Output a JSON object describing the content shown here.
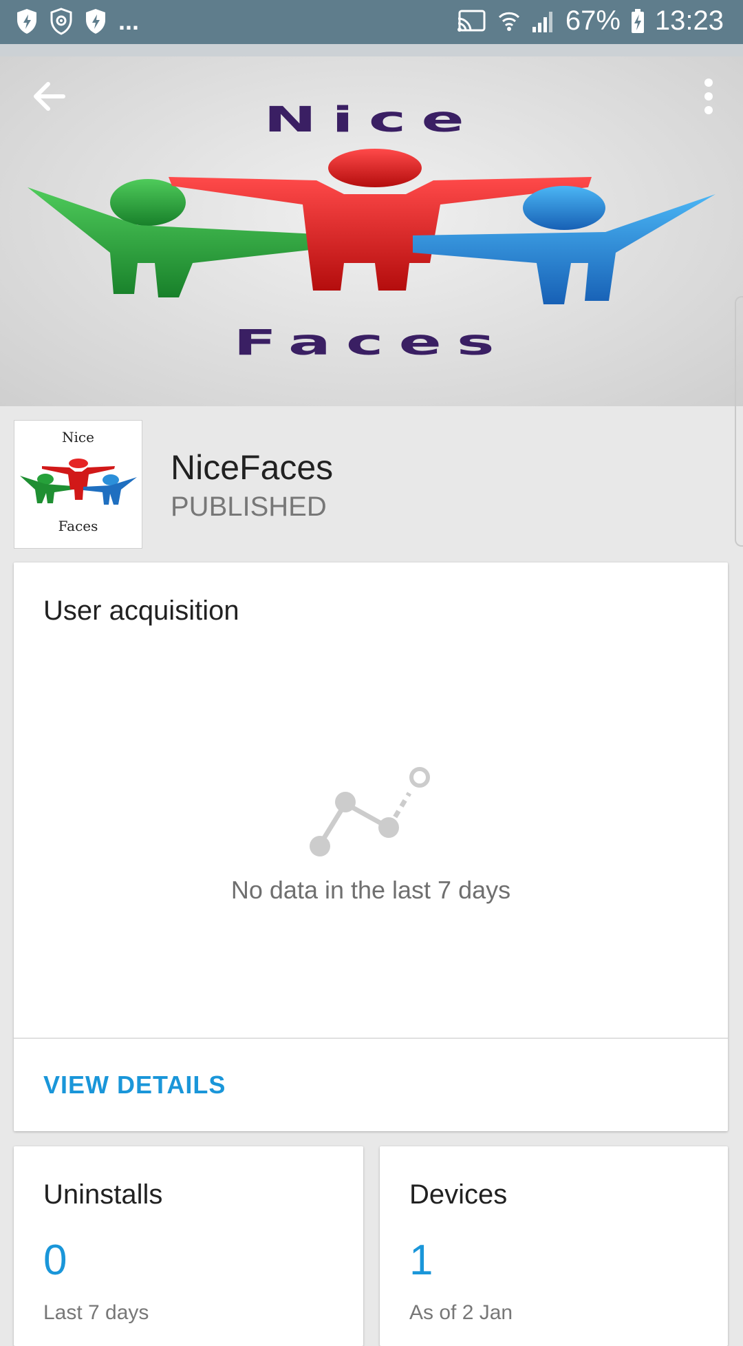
{
  "status_bar": {
    "notification_icons": [
      "shield-bolt-icon",
      "shield-eye-icon",
      "shield-bolt-icon"
    ],
    "overflow": "...",
    "battery": "67%",
    "time": "13:23"
  },
  "header": {
    "banner_top": "Nice",
    "banner_bottom": "Faces"
  },
  "app": {
    "icon_top": "Nice",
    "icon_bottom": "Faces",
    "name": "NiceFaces",
    "status": "PUBLISHED"
  },
  "user_acquisition": {
    "title": "User acquisition",
    "empty_text": "No data in the last 7 days",
    "action": "VIEW DETAILS"
  },
  "uninstalls": {
    "title": "Uninstalls",
    "value": "0",
    "sub": "Last 7 days"
  },
  "devices": {
    "title": "Devices",
    "value": "1",
    "sub": "As of 2 Jan"
  },
  "colors": {
    "status_bar": "#5f7d8c",
    "accent": "#1a96d9",
    "banner_text": "#3a1f63"
  }
}
